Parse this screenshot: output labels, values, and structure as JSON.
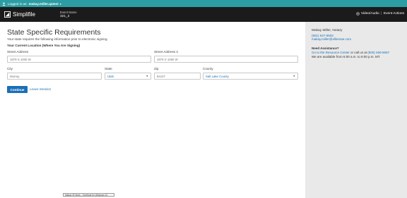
{
  "topbar": {
    "logged_in_label": "Logged in as:",
    "username": "makay.miller.qatest",
    "caret": "▾"
  },
  "header": {
    "brand": "Simplifile",
    "event_label": "Event Name",
    "event_value": "321_2",
    "video_audio": "Video/Audio",
    "separator": "|",
    "event_actions": "Event Actions"
  },
  "form": {
    "title": "State Specific Requirements",
    "subtitle": "Your state requires the following information prior to electronic signing.",
    "location_heading": "Your Current Location (Where You Are Signing)",
    "street_label": "Street Address",
    "street_value": "1879 S 1000 W",
    "street2_label": "Street Address 2",
    "street2_value": "1879 S 1060 W",
    "city_label": "City",
    "city_value": "Murray",
    "state_label": "State",
    "state_value": "Utah",
    "zip_label": "Zip",
    "zip_value": "84107",
    "county_label": "County",
    "county_value": "Salt Lake County",
    "continue_label": "Continue",
    "leave_label": "Leave Session"
  },
  "sidebar": {
    "notary_name": "Makay Miller, Notary",
    "phone": "(801) 647-5603",
    "email": "makay.miller@elliemae.com",
    "assist_heading": "Need Assistance?",
    "resource_link": "Go to the Resource Center",
    "call_text": " or call us at ",
    "support_phone": "(800) 460-5657",
    "hours": "We are available from 6:00 a.m. to 6:00 p.m. MT."
  },
  "tooltip": {
    "text": "Makay @ Work - OneNote for Windows 10"
  },
  "colors": {
    "topbar": "#2b9da3",
    "header": "#1b1b1b",
    "accent": "#1a6fb7",
    "sidebar": "#e9e9e9"
  },
  "icons": {
    "user": "user-icon",
    "brand": "simplifile-logo-icon",
    "camera": "camera-icon",
    "dropdown": "chevron-down-icon"
  }
}
